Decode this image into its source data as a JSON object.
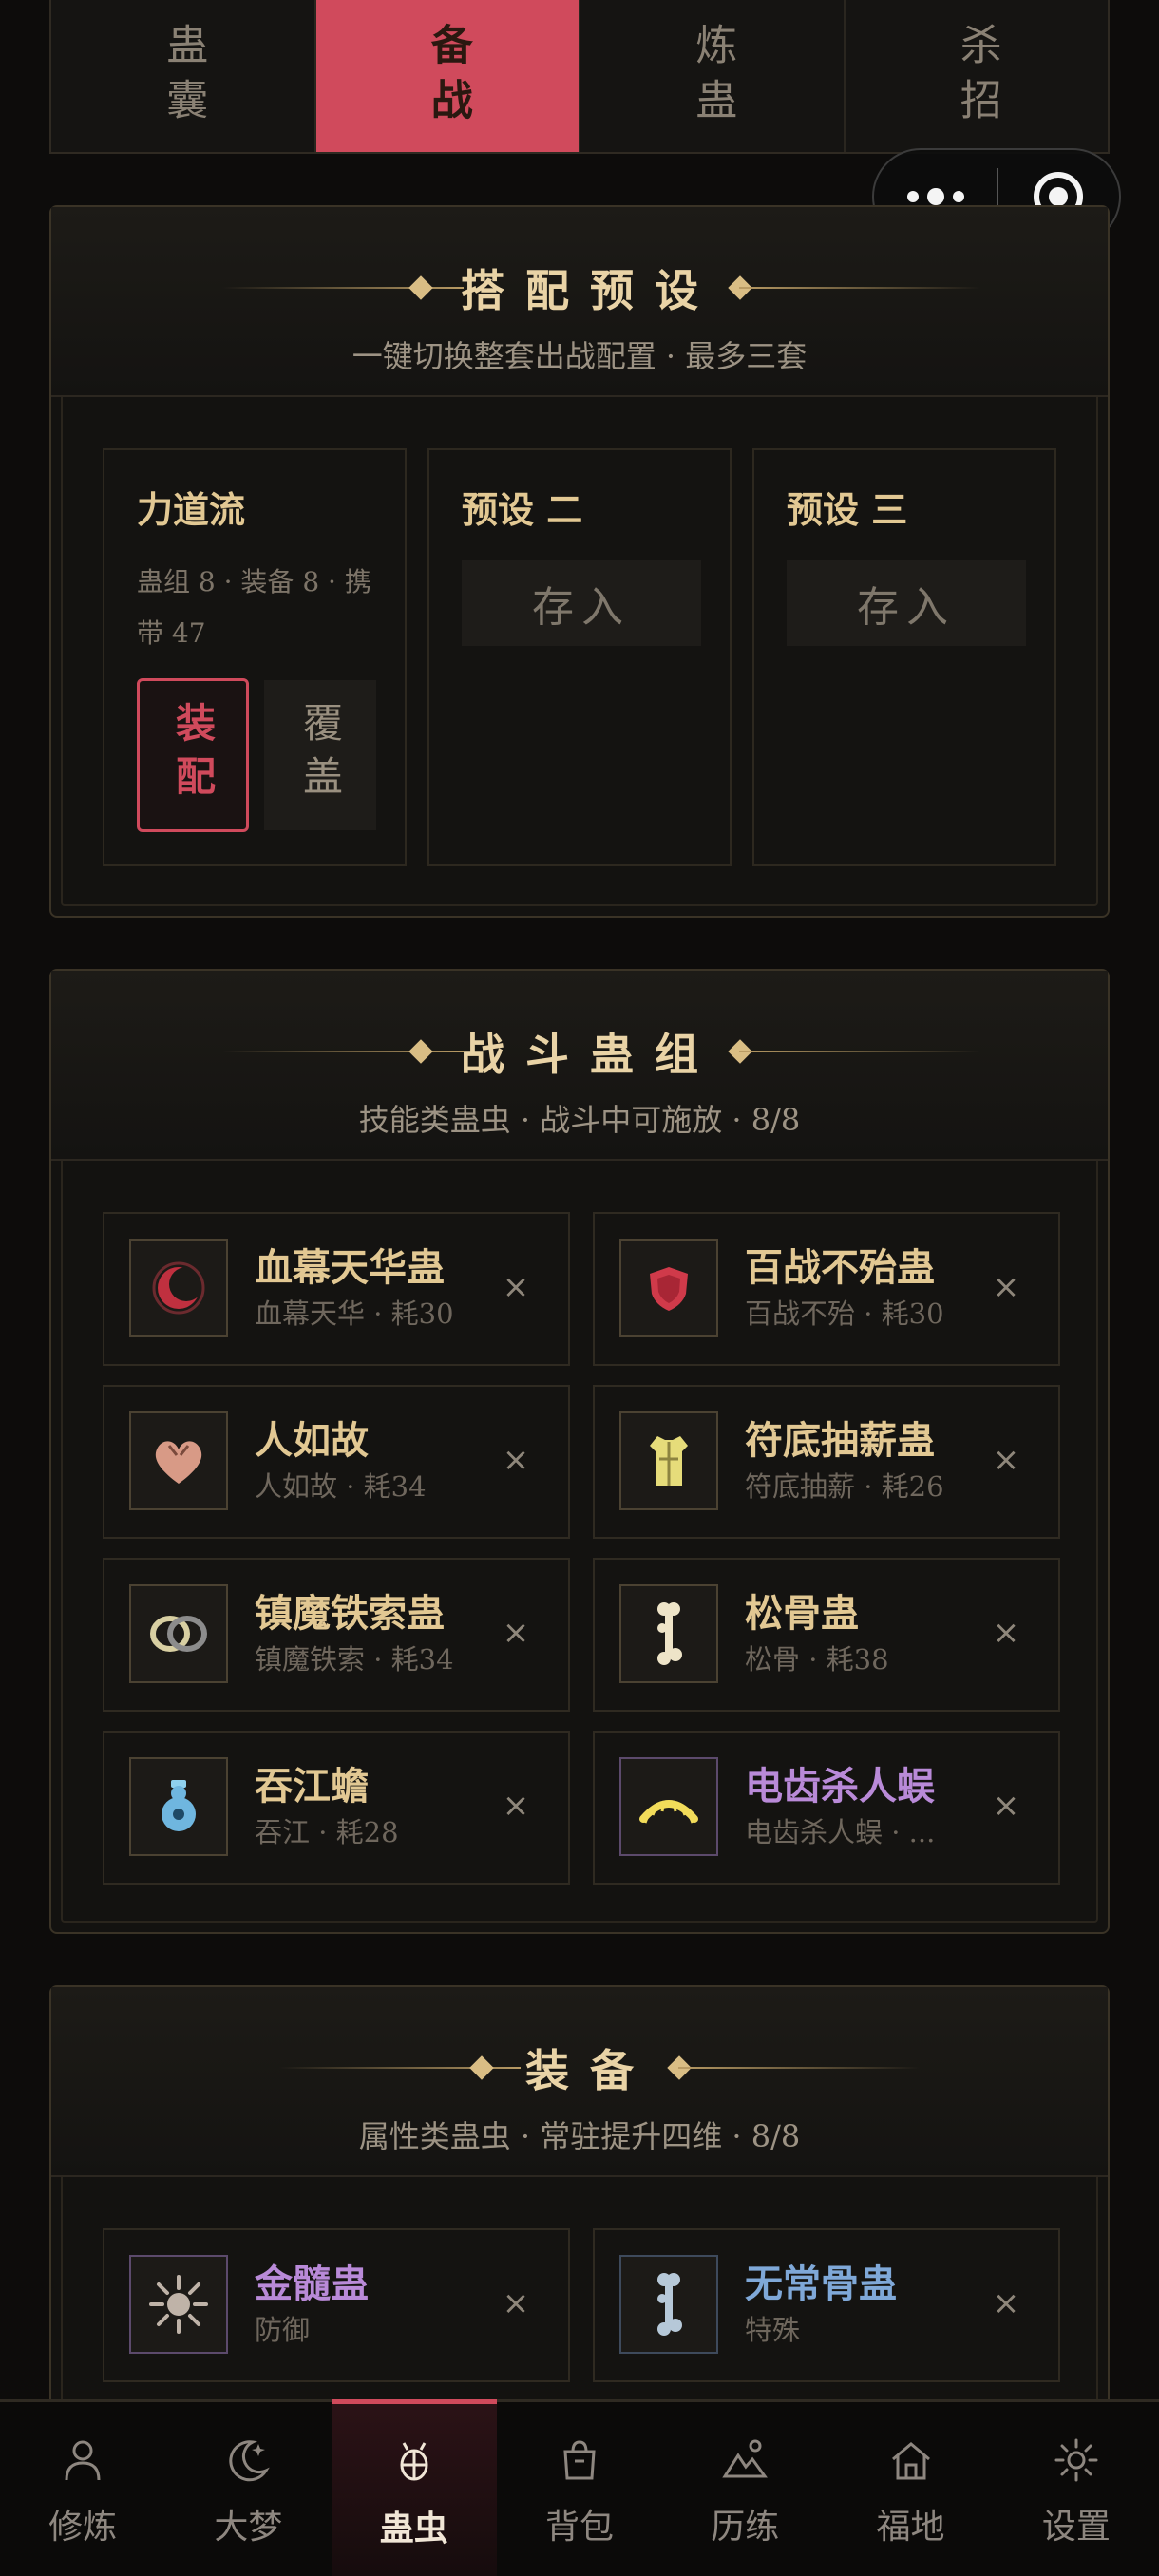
{
  "top_tabs": [
    {
      "label": "蛊囊",
      "active": false
    },
    {
      "label": "备战",
      "active": true
    },
    {
      "label": "炼蛊",
      "active": false
    },
    {
      "label": "杀招",
      "active": false
    }
  ],
  "presets": {
    "title": "搭配预设",
    "subtitle": "一键切换整套出战配置 · 最多三套",
    "cards": [
      {
        "name": "力道流",
        "meta": "蛊组 8 · 装备 8 · 携带 47",
        "equip_label": "装配",
        "cover_label": "覆盖"
      },
      {
        "name": "预设 二",
        "store_label": "存入"
      },
      {
        "name": "预设 三",
        "store_label": "存入"
      }
    ]
  },
  "battle_group": {
    "title": "战斗蛊组",
    "subtitle": "技能类蛊虫 · 战斗中可施放 · 8/8",
    "items": [
      {
        "name": "血幕天华蛊",
        "desc": "血幕天华 · 耗30",
        "icon": "crescent-moon-icon",
        "color": "#e2c893"
      },
      {
        "name": "百战不殆蛊",
        "desc": "百战不殆 · 耗30",
        "icon": "shield-icon",
        "color": "#e2c893"
      },
      {
        "name": "人如故",
        "desc": "人如故 · 耗34",
        "icon": "heart-icon",
        "color": "#e2c893"
      },
      {
        "name": "符底抽薪蛊",
        "desc": "符底抽薪 · 耗26",
        "icon": "armor-icon",
        "color": "#e2c893"
      },
      {
        "name": "镇魔铁索蛊",
        "desc": "镇魔铁索 · 耗34",
        "icon": "chain-icon",
        "color": "#e2c893"
      },
      {
        "name": "松骨蛊",
        "desc": "松骨 · 耗38",
        "icon": "bone-icon",
        "color": "#e2c893"
      },
      {
        "name": "吞江蟾",
        "desc": "吞江 · 耗28",
        "icon": "gourd-icon",
        "color": "#e2c893"
      },
      {
        "name": "电齿杀人蜈",
        "desc": "电齿杀人蜈 · ...",
        "icon": "centipede-icon",
        "color": "#b98ad8"
      }
    ]
  },
  "equipment": {
    "title": "装备",
    "subtitle": "属性类蛊虫 · 常驻提升四维 · 8/8",
    "items": [
      {
        "name": "金髓蛊",
        "desc": "防御",
        "icon": "sun-icon",
        "color": "#b98ad8"
      },
      {
        "name": "无常骨蛊",
        "desc": "特殊",
        "icon": "bone-icon",
        "color": "#7fa8d8"
      }
    ]
  },
  "remove_symbol": "×",
  "bottom_nav": [
    {
      "label": "修炼",
      "icon": "person-icon",
      "active": false
    },
    {
      "label": "大梦",
      "icon": "moon-star-icon",
      "active": false
    },
    {
      "label": "蛊虫",
      "icon": "bug-icon",
      "active": true
    },
    {
      "label": "背包",
      "icon": "bag-icon",
      "active": false
    },
    {
      "label": "历练",
      "icon": "mountain-icon",
      "active": false
    },
    {
      "label": "福地",
      "icon": "home-icon",
      "active": false
    },
    {
      "label": "设置",
      "icon": "gear-icon",
      "active": false
    }
  ],
  "colors": {
    "accent": "#d04a5c",
    "gold": "#e2c893",
    "purple": "#b98ad8",
    "blue": "#7fa8d8"
  }
}
